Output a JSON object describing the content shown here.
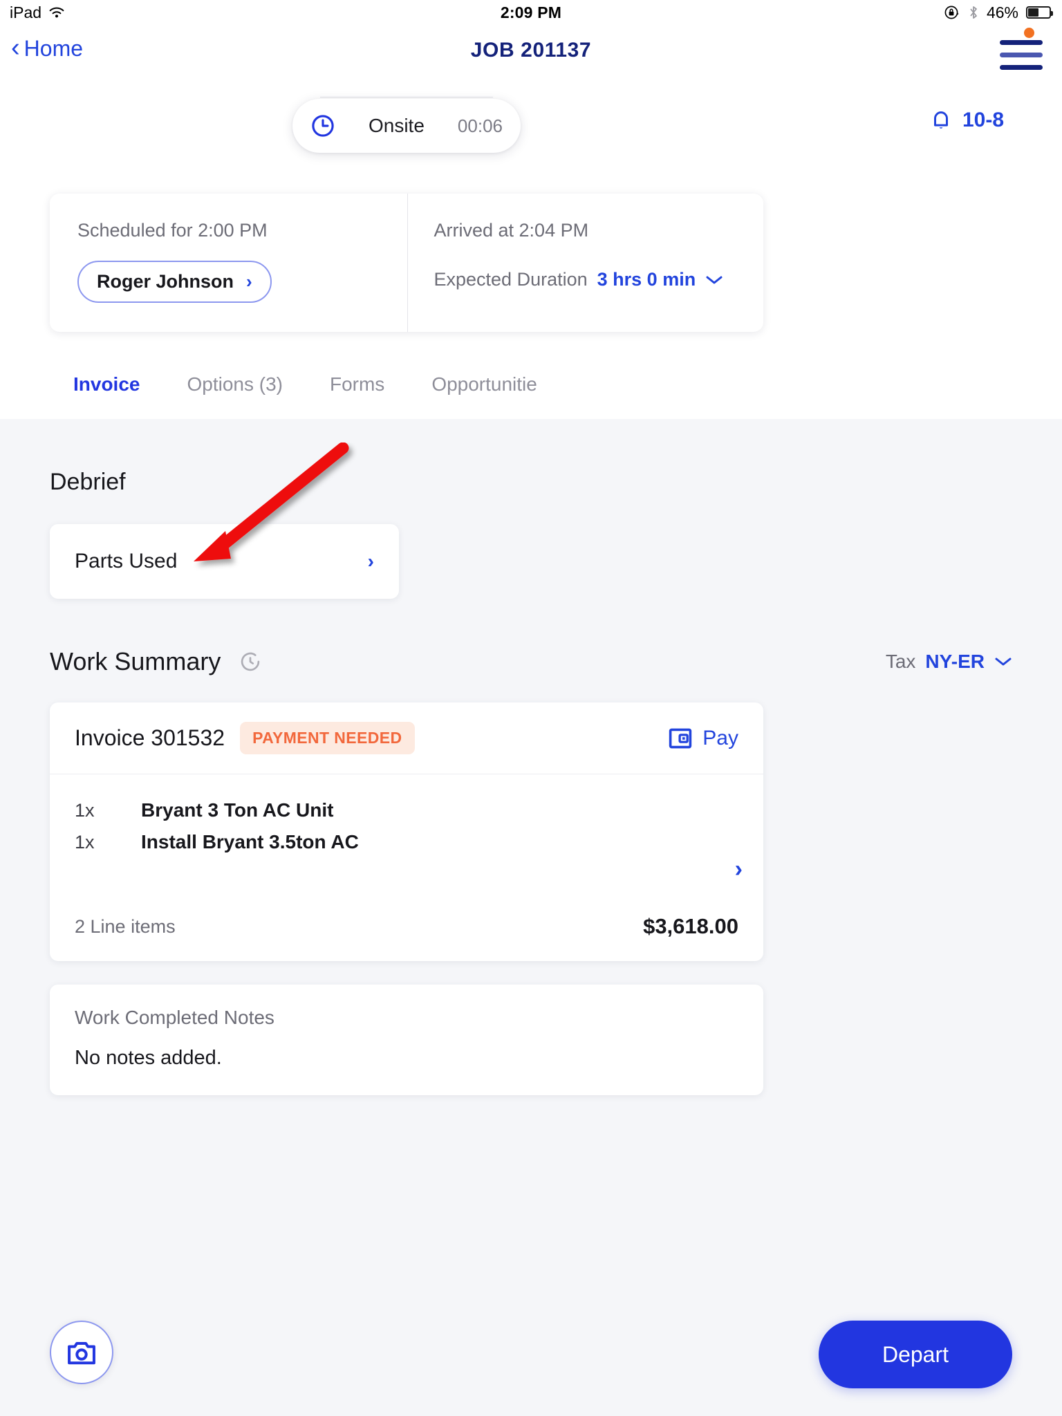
{
  "status_bar": {
    "device": "iPad",
    "wifi_icon": "wifi-icon",
    "time": "2:09 PM",
    "orientation_lock_icon": "rotation-lock-icon",
    "bluetooth_icon": "bluetooth-icon",
    "battery_percent": "46%",
    "battery_icon": "battery-icon"
  },
  "nav": {
    "back_label": "Home",
    "back_icon": "chevron-left-icon",
    "title": "JOB 201137",
    "menu_icon": "hamburger-menu-icon",
    "menu_badge_color": "#f27121"
  },
  "timer": {
    "clock_icon": "clock-icon",
    "status_label": "Onsite",
    "elapsed": "00:06"
  },
  "notifications": {
    "bell_icon": "bell-icon",
    "count_label": "10-8"
  },
  "info_card": {
    "scheduled_label": "Scheduled for 2:00 PM",
    "technician": "Roger Johnson",
    "technician_chevron_icon": "chevron-right-icon",
    "arrived_label": "Arrived at 2:04 PM",
    "duration_label": "Expected Duration",
    "duration_value": "3 hrs 0 min",
    "duration_chevron_icon": "chevron-down-icon"
  },
  "tabs": [
    {
      "label": "Invoice",
      "active": true
    },
    {
      "label": "Options (3)",
      "active": false
    },
    {
      "label": "Forms",
      "active": false
    },
    {
      "label": "Opportunitie",
      "active": false
    }
  ],
  "debrief": {
    "title": "Debrief",
    "parts_used_label": "Parts Used",
    "parts_used_chevron_icon": "chevron-right-icon"
  },
  "work_summary": {
    "title": "Work Summary",
    "refresh_icon": "refresh-icon",
    "tax_label": "Tax",
    "tax_value": "NY-ER",
    "tax_chevron_icon": "chevron-down-icon"
  },
  "invoice": {
    "number_label": "Invoice 301532",
    "status_badge": "PAYMENT NEEDED",
    "badge_color": "#f2683c",
    "badge_bg": "#fdeae0",
    "pay_label": "Pay",
    "pay_icon": "wallet-icon",
    "detail_chevron_icon": "chevron-right-icon",
    "line_items": [
      {
        "qty": "1x",
        "name": "Bryant 3 Ton AC Unit"
      },
      {
        "qty": "1x",
        "name": "Install Bryant 3.5ton AC"
      }
    ],
    "line_count_label": "2 Line items",
    "total": "$3,618.00"
  },
  "notes": {
    "title": "Work Completed Notes",
    "body": "No notes added."
  },
  "bottom": {
    "camera_icon": "camera-icon",
    "depart_label": "Depart"
  },
  "annotation": {
    "arrow_color": "#ee1111",
    "points_to": "Parts Used"
  },
  "theme": {
    "primary_blue": "#2236e0",
    "link_blue": "#2244dd",
    "navy": "#14227a",
    "page_bg": "#f5f6f9",
    "card_bg": "#ffffff"
  }
}
